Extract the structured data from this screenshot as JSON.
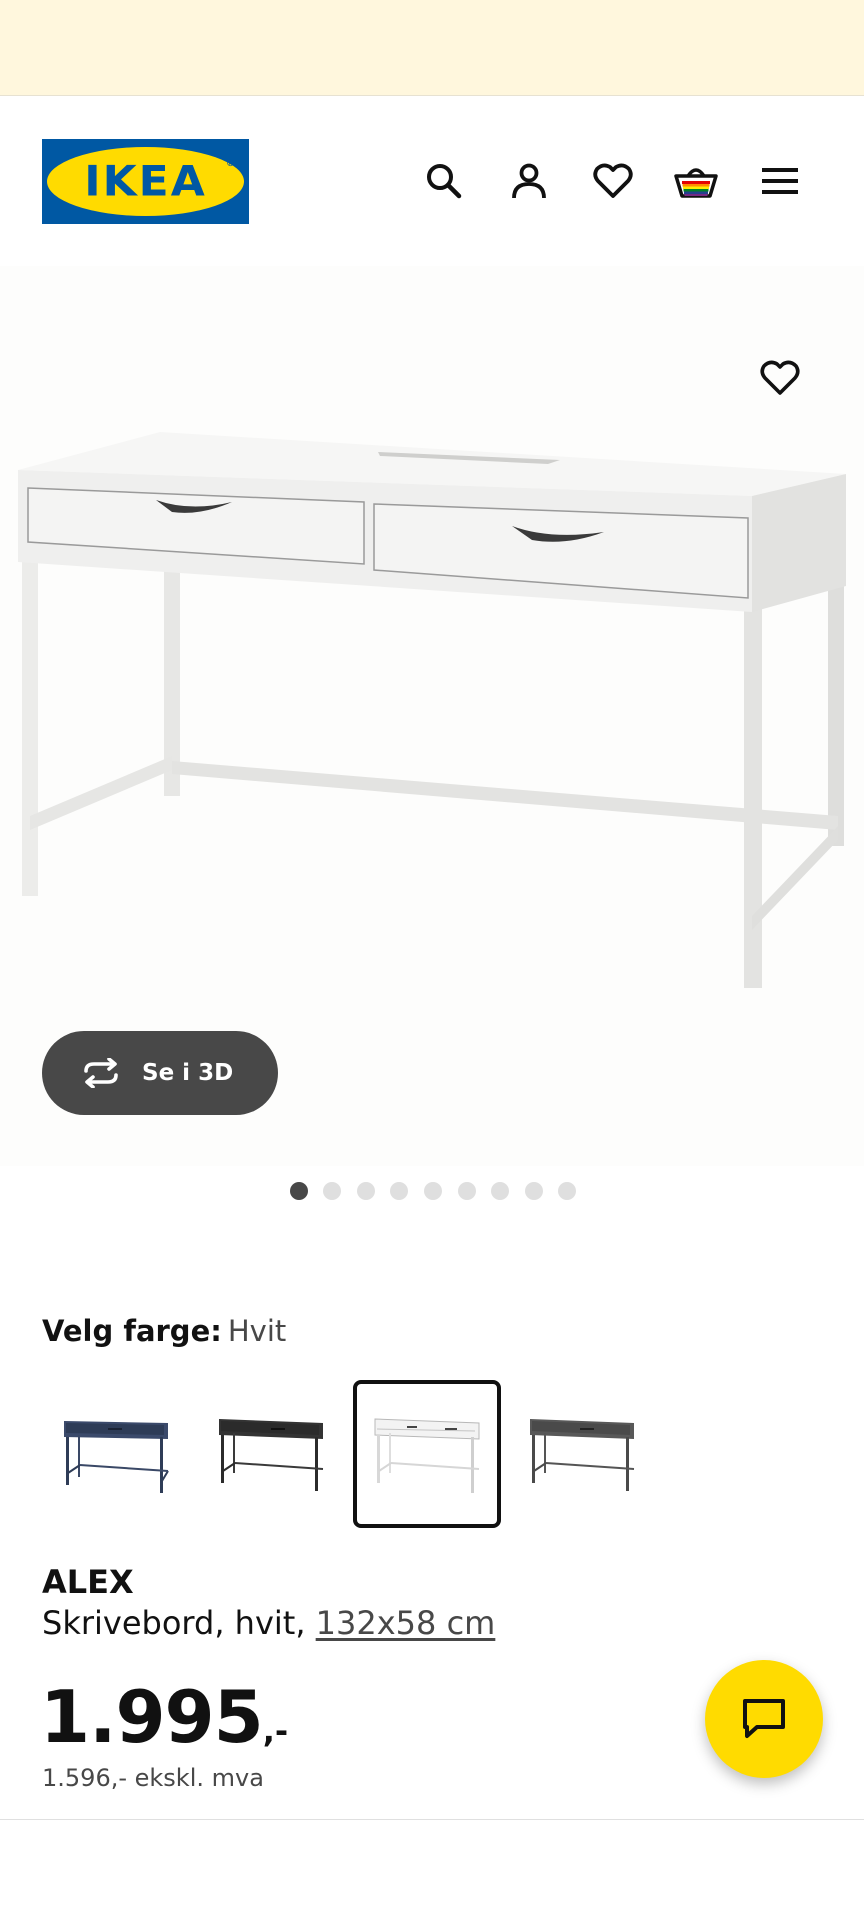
{
  "header": {
    "logo_text": "IKEA",
    "logo_reg": "®",
    "icons": [
      "search-icon",
      "account-icon",
      "heart-icon",
      "basket-icon",
      "menu-icon"
    ]
  },
  "gallery": {
    "view_3d_label": "Se i 3D",
    "dots_total": 9,
    "active_dot": 1
  },
  "color_picker": {
    "label": "Velg farge:",
    "selected_value": "Hvit",
    "options": [
      {
        "name": "blue",
        "color": "#2e3c57"
      },
      {
        "name": "black",
        "color": "#2b2b2b"
      },
      {
        "name": "white",
        "color": "#f1f1f1"
      },
      {
        "name": "grey",
        "color": "#4a4a4a"
      }
    ],
    "selected_index": 2
  },
  "product": {
    "name": "ALEX",
    "description_prefix": "Skrivebord, hvit, ",
    "dimensions": "132x58 cm",
    "price_main": "1.995",
    "price_suffix": ",-",
    "price_ex_vat": "1.596,- ekskl. mva"
  },
  "colors": {
    "banner_bg": "#fff7dd",
    "brand_blue": "#0058a3",
    "brand_yellow": "#ffdb00",
    "dark_button": "#484848"
  }
}
